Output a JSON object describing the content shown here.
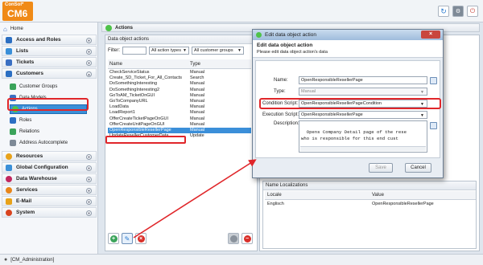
{
  "app": {
    "logo_top": "ConSol*",
    "logo_main": "CM6",
    "status_user": "[CM_Administration]"
  },
  "sidebar": {
    "home": "Home",
    "sections": [
      {
        "label": "Access and Roles",
        "color": "#2c6fc2"
      },
      {
        "label": "Lists",
        "color": "#3a8fd8"
      },
      {
        "label": "Tickets",
        "color": "#3a6fc2"
      },
      {
        "label": "Customers",
        "color": "#2c6fc2"
      },
      {
        "label": "Resources",
        "color": "#e8a21a"
      },
      {
        "label": "Global Configuration",
        "color": "#3a8fd8"
      },
      {
        "label": "Data Warehouse",
        "color": "#c2275e"
      },
      {
        "label": "Services",
        "color": "#e8851a"
      },
      {
        "label": "E-Mail",
        "color": "#e8a21a"
      },
      {
        "label": "System",
        "color": "#d9441f"
      }
    ],
    "customer_items": [
      "Customer Groups",
      "Data Models",
      "Actions",
      "Roles",
      "Relations",
      "Address Autocomplete"
    ]
  },
  "main": {
    "tab_title": "Actions",
    "panel_title": "Data object actions",
    "filter_label": "Filter:",
    "filter_action_types": "All action types",
    "filter_customer_groups": "All customer groups",
    "col_name": "Name",
    "col_type": "Type",
    "rows": [
      [
        "CheckServiceStatus",
        "Manual"
      ],
      [
        "Create_SD_Ticket_For_All_Contacts",
        "Search"
      ],
      [
        "DoSomethingInteresting",
        "Manual"
      ],
      [
        "DoSomethingInteresting2",
        "Manual"
      ],
      [
        "GoToAM_TicketOnGUI",
        "Manual"
      ],
      [
        "GoToCompanyURL",
        "Manual"
      ],
      [
        "LoadData",
        "Manual"
      ],
      [
        "LoadReport1",
        "Manual"
      ],
      [
        "OfferCreateTicketPageOnGUI",
        "Manual"
      ],
      [
        "OfferCreateUnitPageOnGUI",
        "Manual"
      ],
      [
        "OpenResponsibleResellerPage",
        "Manual"
      ],
      [
        "UpdateResellerCustomerData",
        "Update"
      ]
    ],
    "selected_row": 10
  },
  "localizations": {
    "title": "Name Localizations",
    "col_locale": "Locale",
    "col_value": "Value",
    "row_locale": "Englisch",
    "row_value": "OpenResponsibleResellerPage"
  },
  "dialog": {
    "title": "Edit data object action",
    "head_title": "Edit data object action",
    "head_subtitle": "Please edit data object action's data",
    "name_label": "Name:",
    "name_value": "OpenResponsibleResellerPage",
    "type_label": "Type:",
    "type_value": "Manual",
    "condition_label": "Condition Script:",
    "condition_value": "OpenResponsibleResellerPageCondition",
    "execution_label": "Execution Script:",
    "execution_value": "OpenResponsibleResellerPage",
    "description_label": "Description:",
    "description_value": "Opens Company Detail page of the rese\nwho is responsible for this end cust",
    "save_label": "Save",
    "cancel_label": "Cancel"
  },
  "colors": {
    "accent": "#3a8fd8",
    "highlight": "#e0262a",
    "logo": "#f08a16"
  }
}
